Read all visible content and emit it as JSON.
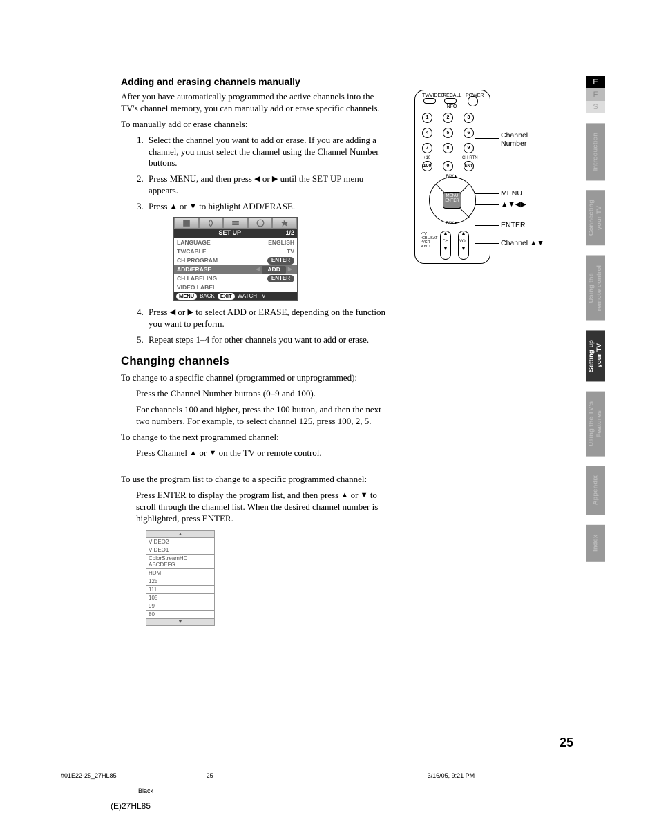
{
  "lang_tabs": {
    "e": "E",
    "f": "F",
    "s": "S"
  },
  "side_tabs": [
    "Introduction",
    "Connecting\nyour TV",
    "Using the\nremote control",
    "Setting up\nyour TV",
    "Using the TV's\nFeatures",
    "Appendix",
    "Index"
  ],
  "h3_1": "Adding and erasing channels manually",
  "p1": "After you have automatically programmed the active channels into the TV's channel memory, you can manually add or erase specific channels.",
  "p2": "To manually add or erase channels:",
  "li1": "Select the channel you want to add or erase. If you are adding a channel, you must select the channel using the Channel Number buttons.",
  "li2a": "Press MENU, and then press ",
  "li2b": " or ",
  "li2c": " until the SET UP menu appears.",
  "li3a": "Press ",
  "li3b": " or ",
  "li3c": " to highlight ADD/ERASE.",
  "osd": {
    "title": "SET UP",
    "page": "1/2",
    "rows": [
      {
        "k": "LANGUAGE",
        "v": "ENGLISH"
      },
      {
        "k": "TV/CABLE",
        "v": "TV"
      },
      {
        "k": "CH PROGRAM",
        "v": "ENTER",
        "pill": true
      },
      {
        "k": "ADD/ERASE",
        "v": "ADD",
        "sel": true,
        "nav": true
      },
      {
        "k": "CH LABELING",
        "v": "ENTER",
        "pill": true
      },
      {
        "k": "VIDEO LABEL",
        "v": ""
      }
    ],
    "foot_menu": "MENU",
    "foot_back": "BACK",
    "foot_exit": "EXIT",
    "foot_watch": "WATCH TV"
  },
  "li4a": "Press ",
  "li4b": " or ",
  "li4c": " to select ADD or ERASE, depending on the function you want to perform.",
  "li5": "Repeat steps 1–4 for other channels you want to add or erase.",
  "h2_1": "Changing channels",
  "cc_p1": "To change to a specific channel (programmed or unprogrammed):",
  "cc_p1a": "Press the Channel Number buttons (0–9 and 100).",
  "cc_p1b": "For channels 100 and higher, press the 100 button, and then the next two numbers. For example, to select channel 125, press 100, 2, 5.",
  "cc_p2": "To change to the next programmed channel:",
  "cc_p2a_a": "Press Channel ",
  "cc_p2a_b": " or ",
  "cc_p2a_c": " on the TV or remote control.",
  "cc_p3": "To use the program list to change to a specific programmed channel:",
  "cc_p3a_a": "Press ENTER to display the program list, and then press ",
  "cc_p3a_b": " or ",
  "cc_p3a_c": " to scroll through the channel list. When the desired channel number is highlighted, press ENTER.",
  "chlist": [
    "VIDEO2",
    "VIDEO1",
    "ColorStreamHD  ABCDEFG",
    "HDMI",
    "125",
    "111",
    "105",
    "99",
    "80"
  ],
  "remote": {
    "top": {
      "tvvideo": "TV/VIDEO",
      "recall": "RECALL",
      "info": "INFO",
      "power": "POWER"
    },
    "num": {
      "n1": "1",
      "n2": "2",
      "n3": "3",
      "n4": "4",
      "n5": "5",
      "n6": "6",
      "n7": "7",
      "n8": "8",
      "n9": "9",
      "n0": "0",
      "n100": "100",
      "chrtn": "CH RTN",
      "ent": "ENT"
    },
    "fav": "FAV",
    "menu": "MENU\nENTER",
    "bottom": {
      "ch": "CH",
      "vol": "VOL",
      "tv": "TV",
      "cblsat": "CBL/SAT",
      "vcr": "VCR",
      "dvd": "DVD"
    }
  },
  "callouts": {
    "chnum": "Channel\nNumber",
    "menu": "MENU",
    "arrows": "▲▼◀▶",
    "enter": "ENTER",
    "chan": "Channel ▲▼"
  },
  "page_num": "25",
  "footer": {
    "file": "#01E22-25_27HL85",
    "pg": "25",
    "ts": "3/16/05, 9:21 PM",
    "black": "Black",
    "model": "(E)27HL85"
  }
}
